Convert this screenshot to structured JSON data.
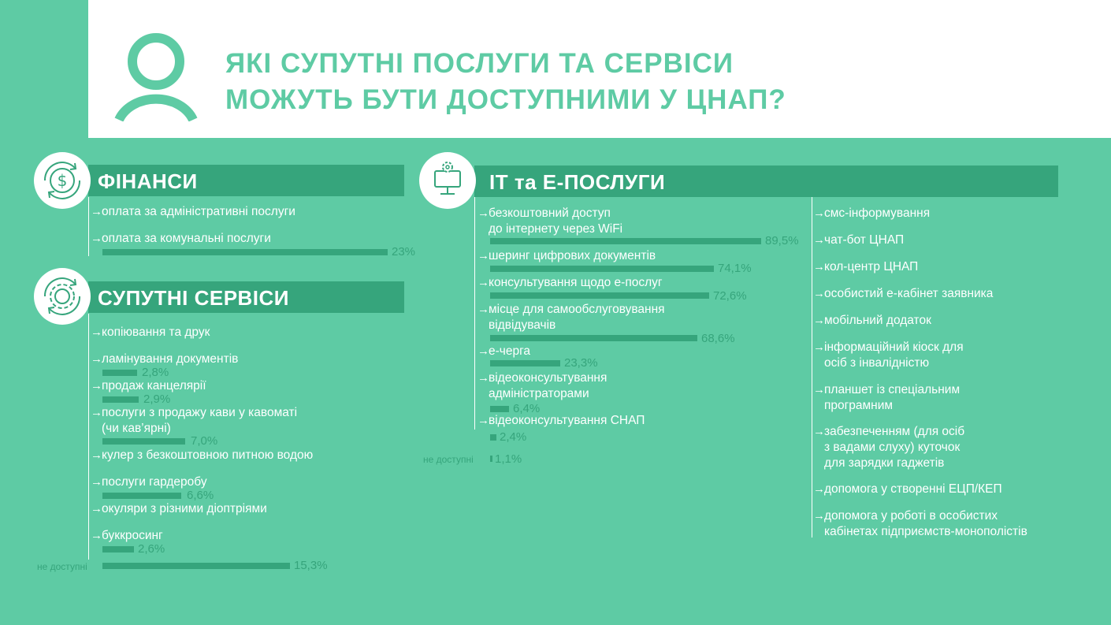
{
  "header": {
    "title_line1": "ЯКІ СУПУТНІ ПОСЛУГИ ТА СЕРВІСИ",
    "title_line2": "МОЖУТЬ БУТИ ДОСТУПНИМИ У ЦНАП?"
  },
  "colors": {
    "background": "#5ecba4",
    "accent_dark": "#36a57c",
    "white": "#ffffff"
  },
  "icons": {
    "header": "person-icon",
    "finance": "dollar-cycle-icon",
    "services": "gear-cycle-icon",
    "it": "computer-gear-icon"
  },
  "finance": {
    "title": "ФІНАНСИ",
    "items": [
      {
        "label": "оплата за адміністративні послуги"
      },
      {
        "label": "оплата за комунальні послуги",
        "pct": "23%",
        "value": 23
      }
    ]
  },
  "services": {
    "title": "СУПУТНІ СЕРВІСИ",
    "items": [
      {
        "label": "копіювання та друк"
      },
      {
        "label": "ламінування документів",
        "pct": "2,8%",
        "value": 2.8
      },
      {
        "label": "продаж канцелярії",
        "pct": "2,9%",
        "value": 2.9
      },
      {
        "label_line1": "послуги з продажу кави у кавоматі",
        "label_line2": "(чи кав’ярні)",
        "pct": "7,0%",
        "value": 7.0
      },
      {
        "label": "кулер з безкоштовною питною водою"
      },
      {
        "label": "послуги гардеробу",
        "pct": "6,6%",
        "value": 6.6
      },
      {
        "label": "окуляри з різними діоптріями"
      },
      {
        "label": "буккросинг",
        "pct": "2,6%",
        "value": 2.6
      }
    ],
    "not_available": {
      "label": "не доступні",
      "pct": "15,3%",
      "value": 15.3
    }
  },
  "it": {
    "title": "ІТ та Е-ПОСЛУГИ",
    "items": [
      {
        "label_line1": "безкоштовний доступ",
        "label_line2": "до інтернету через WiFi",
        "pct": "89,5%",
        "value": 89.5
      },
      {
        "label": "шеринг цифрових документів",
        "pct": "74,1%",
        "value": 74.1
      },
      {
        "label": "консультування щодо е-послуг",
        "pct": "72,6%",
        "value": 72.6
      },
      {
        "label_line1": "місце для самообслуговування",
        "label_line2": "відвідувачів",
        "pct": "68,6%",
        "value": 68.6
      },
      {
        "label": "е-черга",
        "pct": "23,3%",
        "value": 23.3
      },
      {
        "label_line1": "відеоконсультування",
        "label_line2": "адміністраторами",
        "pct": "6,4%",
        "value": 6.4
      },
      {
        "label": "відеоконсультування СНАП",
        "pct": "2,4%",
        "value": 2.4
      }
    ],
    "not_available": {
      "label": "не доступні",
      "pct": "1,1%",
      "value": 1.1
    },
    "right_items": [
      {
        "label": "смс-інформування"
      },
      {
        "label": "чат-бот ЦНАП"
      },
      {
        "label": "кол-центр ЦНАП"
      },
      {
        "label": "особистий е-кабінет заявника"
      },
      {
        "label": "мобільний додаток"
      },
      {
        "label_line1": "інформаційний кіоск для",
        "label_line2": "осіб з інвалідністю"
      },
      {
        "label_line1": "планшет із спеціальним",
        "label_line2": "програмним"
      },
      {
        "label_line1": "забезпеченням (для осіб",
        "label_line2": "з вадами слуху) куточок",
        "label_line3": "для зарядки гаджетів"
      },
      {
        "label": "допомога у створенні ЕЦП/КЕП"
      },
      {
        "label_line1": "допомога у роботі в особистих",
        "label_line2": "кабінетах підприємств-монополістів"
      }
    ]
  }
}
